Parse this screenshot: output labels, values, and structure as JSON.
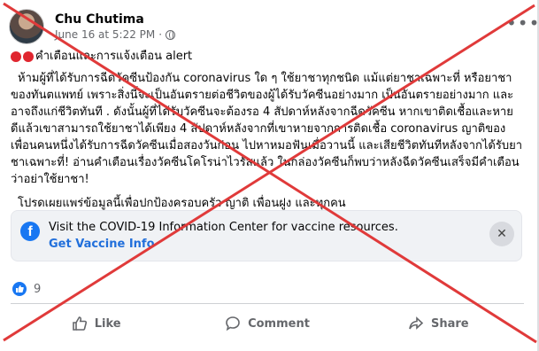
{
  "post": {
    "author": "Chu Chutima",
    "timestamp": "June 16 at 5:22 PM",
    "more_icon": "more-options-icon",
    "headline": "คำเตือนและการแจ้งเตือน alert",
    "paragraph1": "ห้ามผู้ที่ได้รับการฉีดวัคซีนป้องกัน coronavirus ใด ๆ ใช้ยาชาทุกชนิด แม้แต่ยาชาเฉพาะที่ หรือยาชาของทันตแพทย์ เพราะสิ่งนี้จะเป็นอันตรายต่อชีวิตของผู้ได้รับวัคซีนอย่างมาก เป็นอันตรายอย่างมาก และอาจถึงแก่ชีวิตทันที . ดังนั้นผู้ที่ได้รับวัคซีนจะต้องรอ 4 สัปดาห์หลังจากฉีดวัคซีน หากเขาติดเชื้อและหายดีแล้วเขาสามารถใช้ยาชาได้เพียง 4 สัปดาห์หลังจากที่เขาหายจากการติดเชื้อ coronavirus ญาติของเพื่อนคนหนึ่งได้รับการฉีดวัคซีนเมื่อสองวันก่อน ไปหาหมอฟันเมื่อวานนี้ และเสียชีวิตทันทีหลังจากได้รับยาชาเฉพาะที่! อ่านคำเตือนเรื่องวัคซีนโคโรน่าไวรัสแล้ว ในกล่องวัคซีนก็พบว่าหลังฉีดวัคซีนเสร็จมีคำเตือนว่าอย่าใช้ยาชา!",
    "paragraph2": "โปรดเผยแพร่ข้อมูลนี้เพื่อปกป้องครอบครัว ญาติ เพื่อนฝูง และทุกคน"
  },
  "banner": {
    "title": "Visit the COVID-19 Information Center for vaccine resources.",
    "link": "Get Vaccine Info",
    "close_label": "✕"
  },
  "reactions": {
    "count": "9"
  },
  "actions": {
    "like": "Like",
    "comment": "Comment",
    "share": "Share"
  },
  "colors": {
    "accent": "#1877f2",
    "overlay_x": "#e03a3a"
  }
}
